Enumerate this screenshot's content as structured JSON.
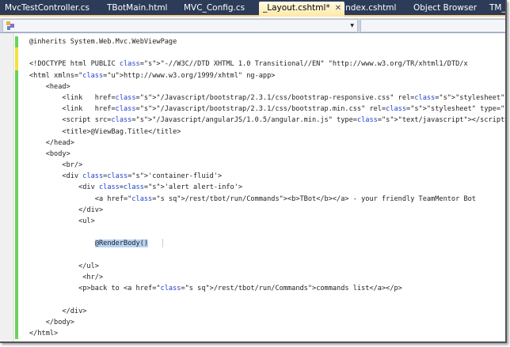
{
  "tabs": [
    {
      "label": "MvcTestController.cs",
      "active": false
    },
    {
      "label": "TBotMain.html",
      "active": false
    },
    {
      "label": "MVC_Config.cs",
      "active": false
    },
    {
      "label": "_Layout.cshtml*",
      "active": true
    },
    {
      "label": "Index.cshtml",
      "active": false
    },
    {
      "label": "Object Browser",
      "active": false
    },
    {
      "label": "TM_",
      "active": false
    }
  ],
  "close_glyph": "✕",
  "colors": {
    "tab_bar": "#2b3b58",
    "active_tab": "#fff3c7",
    "change_saved": "#6ad35a",
    "change_unsaved": "#f1e33c",
    "string": "#a31515",
    "link": "#0000ee"
  },
  "code": [
    {
      "t": "@inherits System.Web.Mvc.WebViewPage",
      "mark": "green"
    },
    {
      "t": "",
      "mark": "yellow"
    },
    {
      "t": "<!DOCTYPE html PUBLIC \"-//W3C//DTD XHTML 1.0 Transitional//EN\" \"http://www.w3.org/TR/xhtml1/DTD/x",
      "mark": "yellow"
    },
    {
      "t": "<html xmlns=\"http://www.w3.org/1999/xhtml\" ng-app>",
      "mark": "green"
    },
    {
      "t": "    <head>",
      "mark": "green"
    },
    {
      "t": "        <link   href=\"/Javascript/bootstrap/2.3.1/css/bootstrap-responsive.css\" rel=\"stylesheet\" ",
      "mark": "green"
    },
    {
      "t": "        <link   href=\"/Javascript/bootstrap/2.3.1/css/bootstrap.min.css\" rel=\"stylesheet\" type=\"t",
      "mark": "green"
    },
    {
      "t": "        <script src=\"/Javascript/angularJS/1.0.5/angular.min.js\" type=\"text/javascript\"></script>",
      "mark": "green"
    },
    {
      "t": "        <title>@ViewBag.Title</title>",
      "mark": "green"
    },
    {
      "t": "    </head>",
      "mark": "green"
    },
    {
      "t": "    <body>",
      "mark": "green"
    },
    {
      "t": "        <br/>",
      "mark": "green"
    },
    {
      "t": "        <div class='container-fluid'>",
      "mark": "green"
    },
    {
      "t": "            <div class='alert alert-info'>",
      "mark": "green"
    },
    {
      "t": "                <a href=\"/rest/tbot/run/Commands\"><b>TBot</b></a> - your friendly TeamMentor Bot",
      "mark": "green"
    },
    {
      "t": "            </div>",
      "mark": "green"
    },
    {
      "t": "            <ul>",
      "mark": "green"
    },
    {
      "t": "",
      "mark": "green"
    },
    {
      "t": "                @RenderBody()",
      "mark": "green"
    },
    {
      "t": "",
      "mark": "green"
    },
    {
      "t": "            </ul>",
      "mark": "green"
    },
    {
      "t": "             <hr/>",
      "mark": "green"
    },
    {
      "t": "            <p>back to <a href=\"/rest/tbot/run/Commands\">commands list</a></p>",
      "mark": "green"
    },
    {
      "t": "",
      "mark": "green"
    },
    {
      "t": "        </div>",
      "mark": "green"
    },
    {
      "t": "    </body>",
      "mark": "green"
    },
    {
      "t": "</html>",
      "mark": "green"
    }
  ]
}
